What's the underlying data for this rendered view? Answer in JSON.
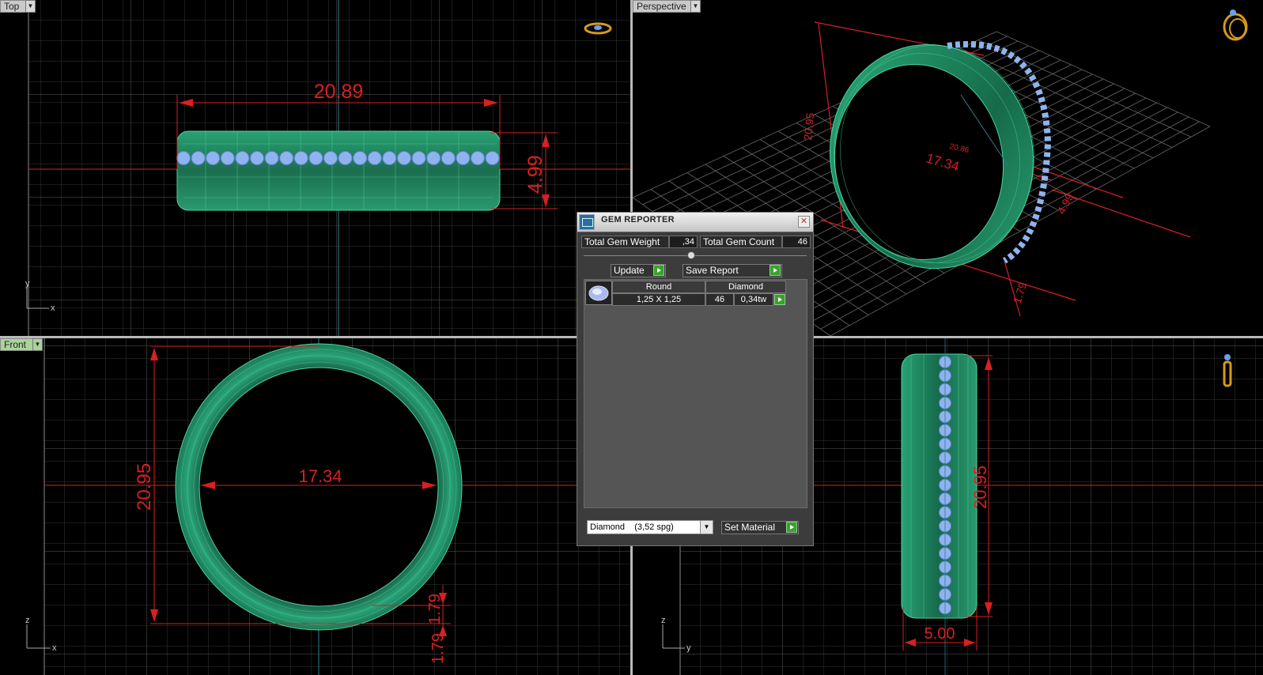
{
  "viewports": {
    "top": {
      "label": "Top",
      "dim_width": "20.89",
      "dim_height": "4.99",
      "axis_1": "y",
      "axis_2": "x"
    },
    "perspective": {
      "label": "Perspective",
      "dim_outer": "20.95",
      "dim_inner": "17.34",
      "dim_small": "20.86",
      "dim_width": "4.99",
      "dim_thick": "1.79"
    },
    "front": {
      "label": "Front",
      "dim_outer": "20.95",
      "dim_inner": "17.34",
      "dim_thick": "1.79",
      "axis_1": "z",
      "axis_2": "x"
    },
    "right": {
      "dim_height": "20.95",
      "dim_width": "5.00",
      "axis_1": "z",
      "axis_2": "y"
    }
  },
  "gem_reporter": {
    "title": "GEM REPORTER",
    "total_gem_weight_label": "Total Gem Weight",
    "total_gem_weight_value": ",34",
    "total_gem_count_label": "Total Gem Count",
    "total_gem_count_value": "46",
    "update_label": "Update",
    "save_report_label": "Save Report",
    "table_headers": [
      "Round",
      "Diamond"
    ],
    "rows": [
      {
        "size": "1,25 X 1,25",
        "count": "46",
        "weight": "0,34tw"
      }
    ],
    "material_select": "Diamond    (3,52 spg)",
    "set_material_label": "Set Material"
  },
  "colors": {
    "ring": "#1e8a62",
    "gem": "#8fb3ef",
    "dimension": "#d82020",
    "grid": "#3c3c3c",
    "active_label": "#a9d39b"
  }
}
